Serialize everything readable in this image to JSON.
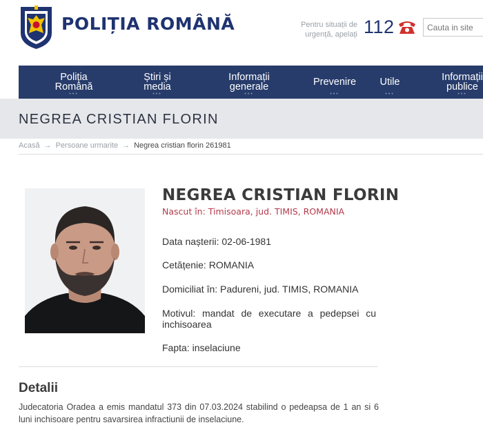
{
  "header": {
    "brand": "POLIȚIA ROMÂNĂ",
    "emergency_text": "Pentru situații de urgență, apelați",
    "emergency_number": "112",
    "search_placeholder": "Cauta in site"
  },
  "nav": [
    {
      "line1": "Poliția",
      "line2": "Română"
    },
    {
      "line1": "Știri și",
      "line2": "media"
    },
    {
      "line1": "Informații",
      "line2": "generale"
    },
    {
      "line1": "Prevenire",
      "line2": ""
    },
    {
      "line1": "Utile",
      "line2": ""
    },
    {
      "line1": "Informații",
      "line2": "publice"
    }
  ],
  "page_title": "NEGREA CRISTIAN FLORIN",
  "breadcrumb": {
    "home": "Acasă",
    "section": "Persoane urmarite",
    "current": "Negrea cristian florin 261981"
  },
  "person": {
    "name": "NEGREA CRISTIAN FLORIN",
    "born": "Nascut în: Timisoara, jud. TIMIS, ROMANIA",
    "birthdate": "Data nașterii: 02-06-1981",
    "citizenship": "Cetățenie: ROMANIA",
    "residence": "Domiciliat în: Padureni, jud. TIMIS, ROMANIA",
    "reason": "Motivul: mandat de executare a pedepsei cu inchisoarea",
    "deed": "Fapta: inselaciune"
  },
  "details": {
    "heading": "Detalii",
    "text": "Judecatoria Oradea a emis mandatul 373 din 07.03.2024 stabilind o pedeapsa de 1 an si 6 luni inchisoare pentru savarsirea infractiunii de inselaciune."
  },
  "colors": {
    "brand_blue": "#1f3370",
    "nav_bg": "#273c6b",
    "accent_red": "#b33a4b"
  }
}
